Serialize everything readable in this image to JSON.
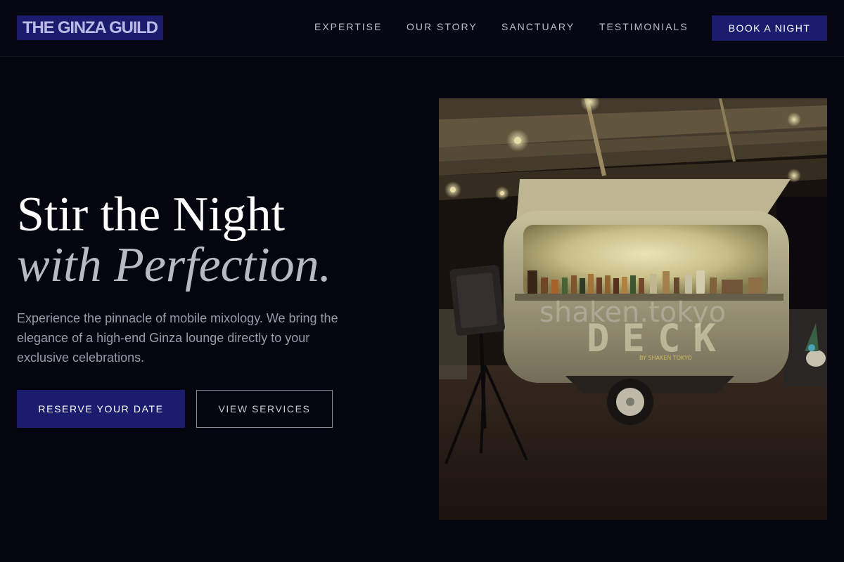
{
  "brand": {
    "logo_text": "THE GINZA GUILD"
  },
  "nav": {
    "items": [
      "EXPERTISE",
      "OUR STORY",
      "SANCTUARY",
      "TESTIMONIALS"
    ],
    "cta_label": "BOOK A NIGHT"
  },
  "hero": {
    "title_line1": "Stir the Night",
    "title_line2": "with Perfection.",
    "description": "Experience the pinnacle of mobile mixology. We bring the elegance of a high-end Ginza lounge directly to your exclusive celebrations.",
    "primary_cta": "RESERVE YOUR DATE",
    "secondary_cta": "VIEW SERVICES"
  },
  "photo": {
    "watermark": "shaken.tokyo",
    "sign_text": "DECK",
    "sub_sign": "BY SHAKEN TOKYO"
  },
  "colors": {
    "background": "#05050f",
    "accent": "#1b1c6e",
    "nav_text": "#bcbcc8"
  }
}
